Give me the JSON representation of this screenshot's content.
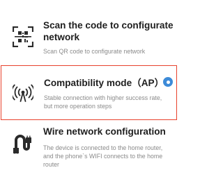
{
  "options": [
    {
      "title": "Scan the code to configurate network",
      "description": "Scan QR code to configurate network",
      "icon": "qr-scan-icon",
      "selected": false
    },
    {
      "title": "Compatibility mode（AP）",
      "description": "Stable connection with higher success rate, but more operation steps",
      "icon": "antenna-signal-icon",
      "selected": true
    },
    {
      "title": "Wire network configuration",
      "description": "The device is connected to the home router, and the phone`s WIFI connects to the home router",
      "icon": "ethernet-cable-icon",
      "selected": false
    }
  ],
  "colors": {
    "selected_border": "#e8412c",
    "radio_selected": "#3d8bd8",
    "title_text": "#1e1e1e",
    "description_text": "#8a8a8a"
  }
}
